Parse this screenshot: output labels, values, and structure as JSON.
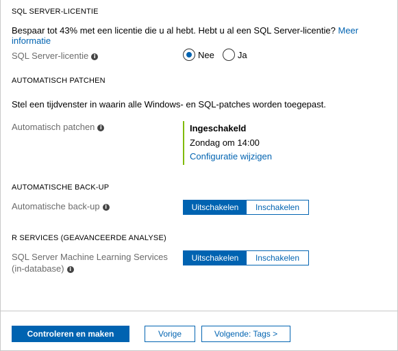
{
  "license": {
    "section_title": "SQL SERVER-LICENTIE",
    "description": "Bespaar tot 43% met een licentie die u al hebt. Hebt u al een SQL Server-licentie?",
    "link": "Meer informatie",
    "field_label": "SQL Server-licentie",
    "options": [
      "Nee",
      "Ja"
    ],
    "selected": "Nee"
  },
  "patching": {
    "section_title": "AUTOMATISCH PATCHEN",
    "description": "Stel een tijdvenster in waarin alle Windows- en SQL-patches worden toegepast.",
    "field_label": "Automatisch patchen",
    "status": "Ingeschakeld",
    "schedule": "Zondag om 14:00",
    "link": "Configuratie wijzigen",
    "accent": "#7fba00"
  },
  "backup": {
    "section_title": "AUTOMATISCHE BACK-UP",
    "field_label": "Automatische back-up",
    "toggle": [
      "Uitschakelen",
      "Inschakelen"
    ],
    "selected": "Uitschakelen"
  },
  "rservices": {
    "section_title": "R SERVICES (GEAVANCEERDE ANALYSE)",
    "field_label_line1": "SQL Server Machine Learning Services",
    "field_label_line2": "(in-database)",
    "toggle": [
      "Uitschakelen",
      "Inschakelen"
    ],
    "selected": "Uitschakelen"
  },
  "footer": {
    "review_create": "Controleren en maken",
    "previous": "Vorige",
    "next": "Volgende: Tags >"
  },
  "icons": {
    "info": "i"
  },
  "colors": {
    "accent": "#0063b1",
    "label": "#6b6b6b"
  }
}
